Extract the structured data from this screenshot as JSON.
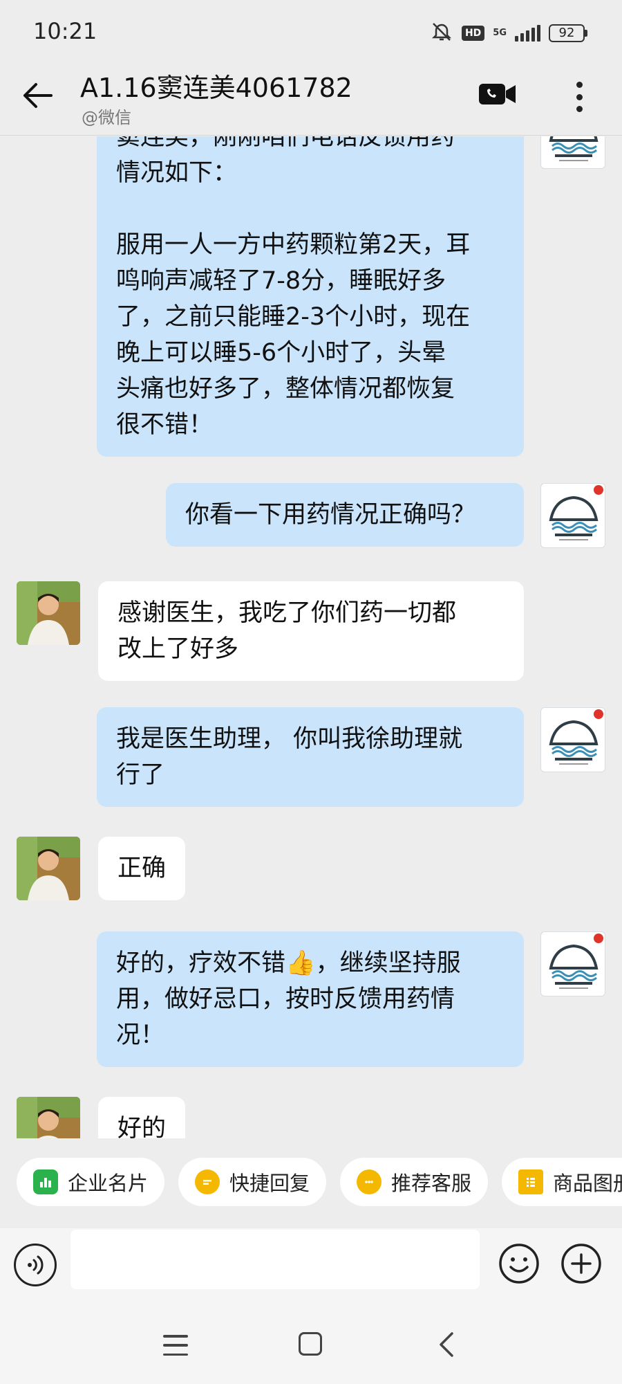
{
  "status_bar": {
    "time": "10:21",
    "network": "5G",
    "hd_badge": "HD",
    "battery": "92"
  },
  "header": {
    "title": "A1.16窦连美4061782",
    "subtitle": "@微信"
  },
  "messages": [
    {
      "direction": "out",
      "text": "窦连美，刚刚咱们电话反馈用药\n情况如下：\n\n服用一人一方中药颗粒第2天，耳\n鸣响声减轻了7-8分，睡眠好多\n了，之前只能睡2-3个小时，现在\n晚上可以睡5-6个小时了，头晕\n头痛也好多了，整体情况都恢复\n很不错！"
    },
    {
      "direction": "out",
      "text": "你看一下用药情况正确吗？"
    },
    {
      "direction": "in",
      "text": "感谢医生，我吃了你们药一切都\n改上了好多"
    },
    {
      "direction": "out",
      "text": "我是医生助理， 你叫我徐助理就\n行了"
    },
    {
      "direction": "in",
      "text": "正确"
    },
    {
      "direction": "out",
      "text": "好的，疗效不错👍，继续坚持服\n用，做好忌口，按时反馈用药情\n况！"
    },
    {
      "direction": "in",
      "text": "好的"
    }
  ],
  "quick_actions": [
    {
      "label": "企业名片",
      "icon": "business-card-icon",
      "color": "#2bb24c"
    },
    {
      "label": "快捷回复",
      "icon": "quick-reply-icon",
      "color": "#f5b800"
    },
    {
      "label": "推荐客服",
      "icon": "customer-service-icon",
      "color": "#f5b800"
    },
    {
      "label": "商品图册",
      "icon": "product-album-icon",
      "color": "#f5b800"
    }
  ],
  "input": {
    "placeholder": ""
  },
  "colors": {
    "background": "#ededed",
    "outgoing_bubble": "#c9e4fb",
    "incoming_bubble": "#ffffff",
    "badge_red": "#e0342b"
  }
}
